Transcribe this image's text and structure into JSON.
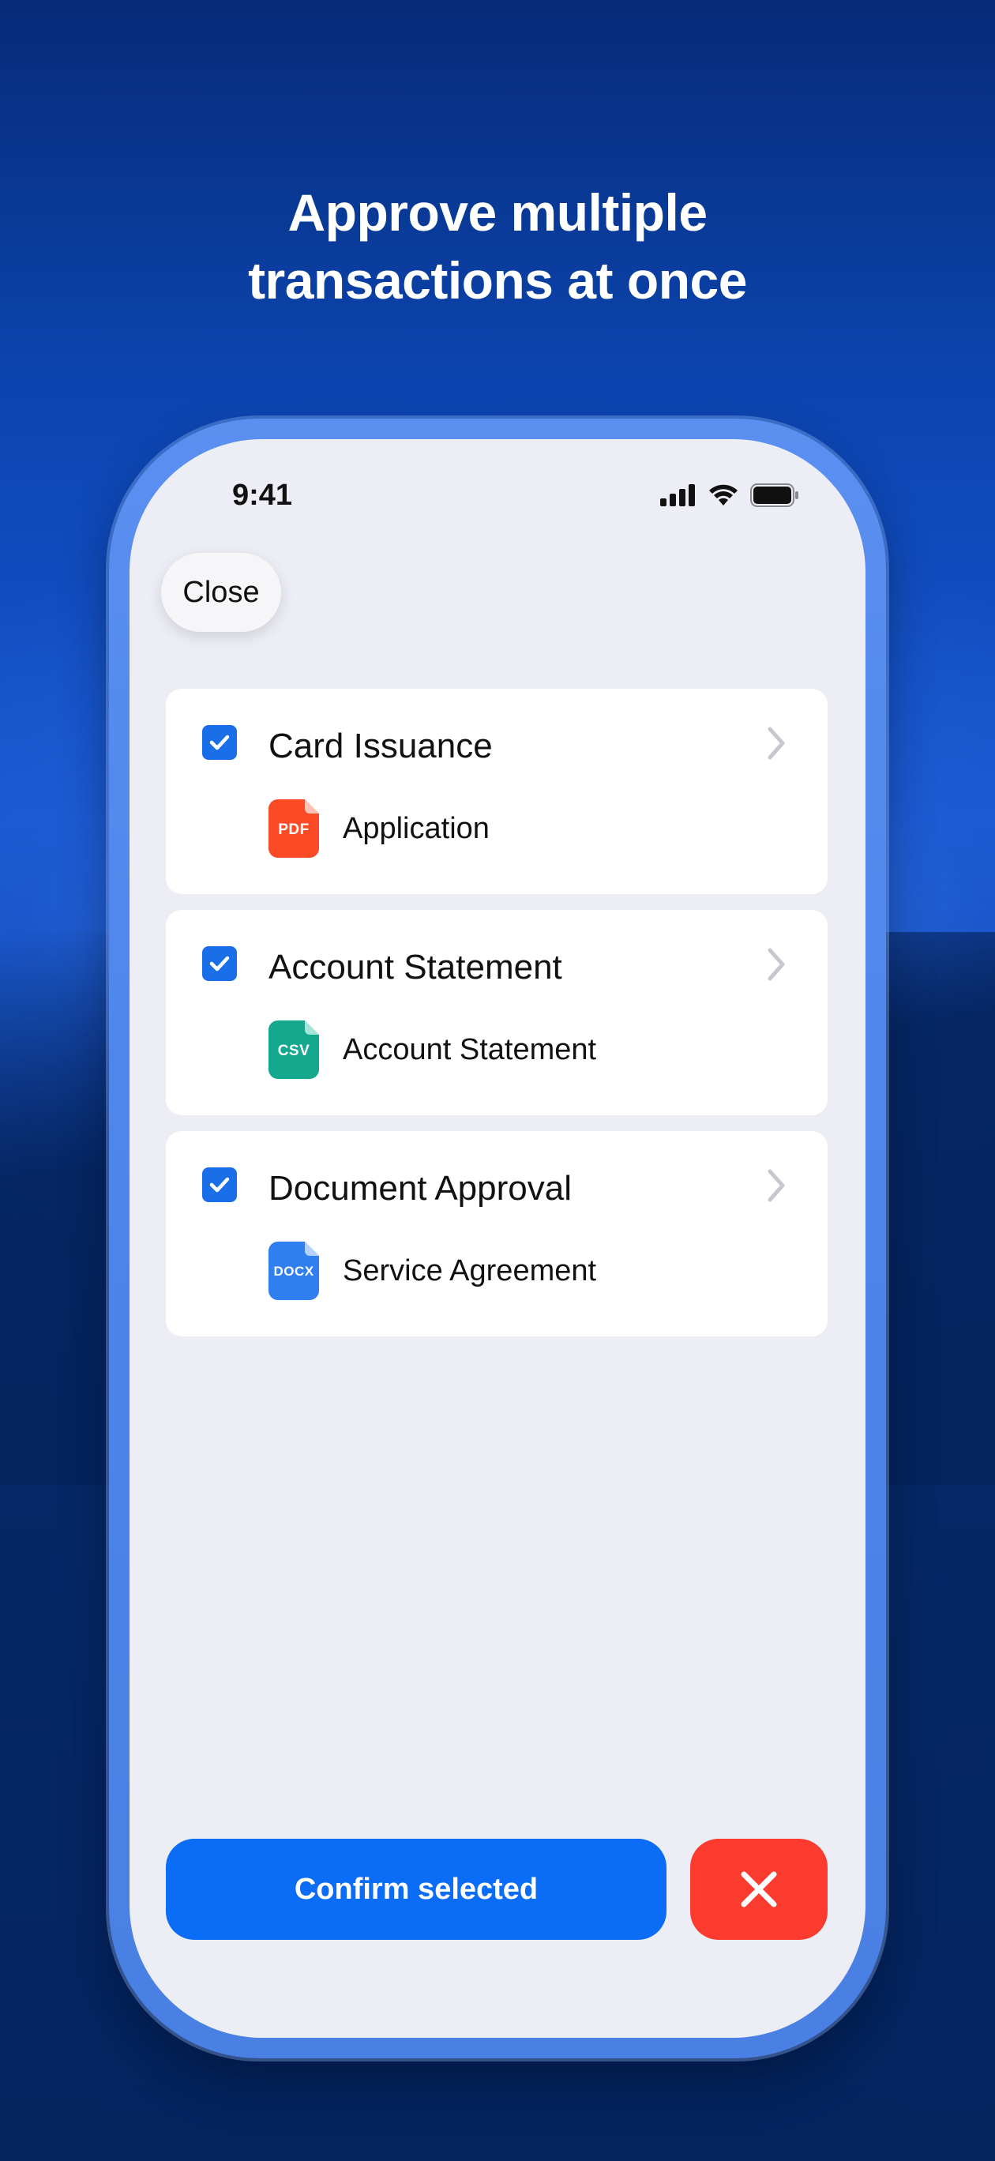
{
  "headline": {
    "line1": "Approve multiple",
    "line2": "transactions at once"
  },
  "status_bar": {
    "time": "9:41",
    "icons": [
      "cellular-signal-icon",
      "wifi-icon",
      "battery-icon"
    ]
  },
  "close_button": {
    "label": "Close"
  },
  "transactions": [
    {
      "title": "Card Issuance",
      "checked": true,
      "file": {
        "type": "PDF",
        "name": "Application",
        "color": "#fb4a26"
      }
    },
    {
      "title": "Account Statement",
      "checked": true,
      "file": {
        "type": "CSV",
        "name": "Account Statement",
        "color": "#14a88e"
      }
    },
    {
      "title": "Document Approval",
      "checked": true,
      "file": {
        "type": "DOCX",
        "name": "Service Agreement",
        "color": "#2f7ff0"
      }
    }
  ],
  "actions": {
    "confirm_label": "Confirm selected",
    "reject_icon": "close-x-icon"
  },
  "colors": {
    "accent": "#0b6cf5",
    "reject": "#fb3b2d",
    "checkbox": "#1a6fe8",
    "screen_background": "#ecedf5"
  }
}
